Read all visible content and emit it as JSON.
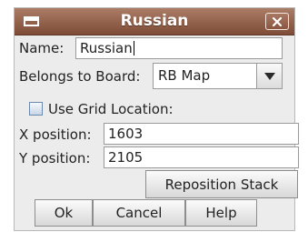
{
  "dialog": {
    "title": "Russian",
    "fields": {
      "name_label": "Name:",
      "name_value": "Russian",
      "board_label": "Belongs to Board:",
      "board_value": "RB Map",
      "grid_checkbox_label": "Use Grid Location:",
      "grid_checked": false,
      "x_label": "X position:",
      "x_value": "1603",
      "y_label": "Y position:",
      "y_value": "2105"
    },
    "buttons": {
      "reposition": "Reposition Stack",
      "ok": "Ok",
      "cancel": "Cancel",
      "help": "Help"
    }
  },
  "colors": {
    "titlebar": "#8f5d47",
    "window_bg": "#ececec"
  },
  "icons": {
    "window_menu": "window-icon",
    "close": "close-icon",
    "dropdown": "triangle-down-icon"
  }
}
